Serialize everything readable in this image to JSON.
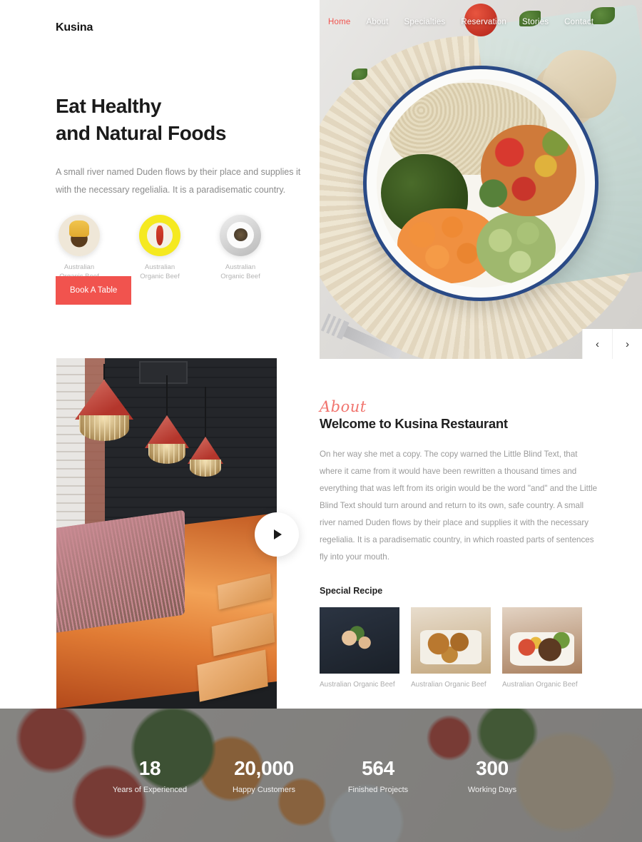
{
  "brand": {
    "logo": "Kusina"
  },
  "nav": {
    "items": [
      {
        "label": "Home",
        "active": true
      },
      {
        "label": "About",
        "active": false
      },
      {
        "label": "Specialties",
        "active": false
      },
      {
        "label": "Reservation",
        "active": false
      },
      {
        "label": "Stories",
        "active": false
      },
      {
        "label": "Contact",
        "active": false
      }
    ]
  },
  "hero": {
    "heading_line1": "Eat Healthy",
    "heading_line2": "and Natural Foods",
    "lead": "A small river named Duden flows by their place and supplies it with the necessary regelialia. It is a paradisematic country.",
    "cta_label": "Book A Table",
    "thumbs": [
      {
        "caption": "Australian Organic Beef"
      },
      {
        "caption": "Australian Organic Beef"
      },
      {
        "caption": "Australian Organic Beef"
      }
    ],
    "slider": {
      "prev": "‹",
      "next": "›"
    }
  },
  "about": {
    "eyebrow": "About",
    "title": "Welcome to Kusina Restaurant",
    "body": "On her way she met a copy. The copy warned the Little Blind Text, that where it came from it would have been rewritten a thousand times and everything that was left from its origin would be the word \"and\" and the Little Blind Text should turn around and return to its own, safe country. A small river named Duden flows by their place and supplies it with the necessary regelialia. It is a paradisematic country, in which roasted parts of sentences fly into your mouth.",
    "recipes_title": "Special Recipe",
    "recipes": [
      {
        "caption": "Australian Organic Beef"
      },
      {
        "caption": "Australian Organic Beef"
      },
      {
        "caption": "Australian Organic Beef"
      }
    ]
  },
  "video": {
    "play_label": "play"
  },
  "stats": {
    "items": [
      {
        "number": "18",
        "label": "Years of Experienced"
      },
      {
        "number": "20,000",
        "label": "Happy Customers"
      },
      {
        "number": "564",
        "label": "Finished Projects"
      },
      {
        "number": "300",
        "label": "Working Days"
      }
    ]
  },
  "colors": {
    "accent": "#f1534e",
    "script_accent": "#f1756f",
    "heading": "#1b1b1b",
    "muted_text": "#9a9a9a"
  }
}
